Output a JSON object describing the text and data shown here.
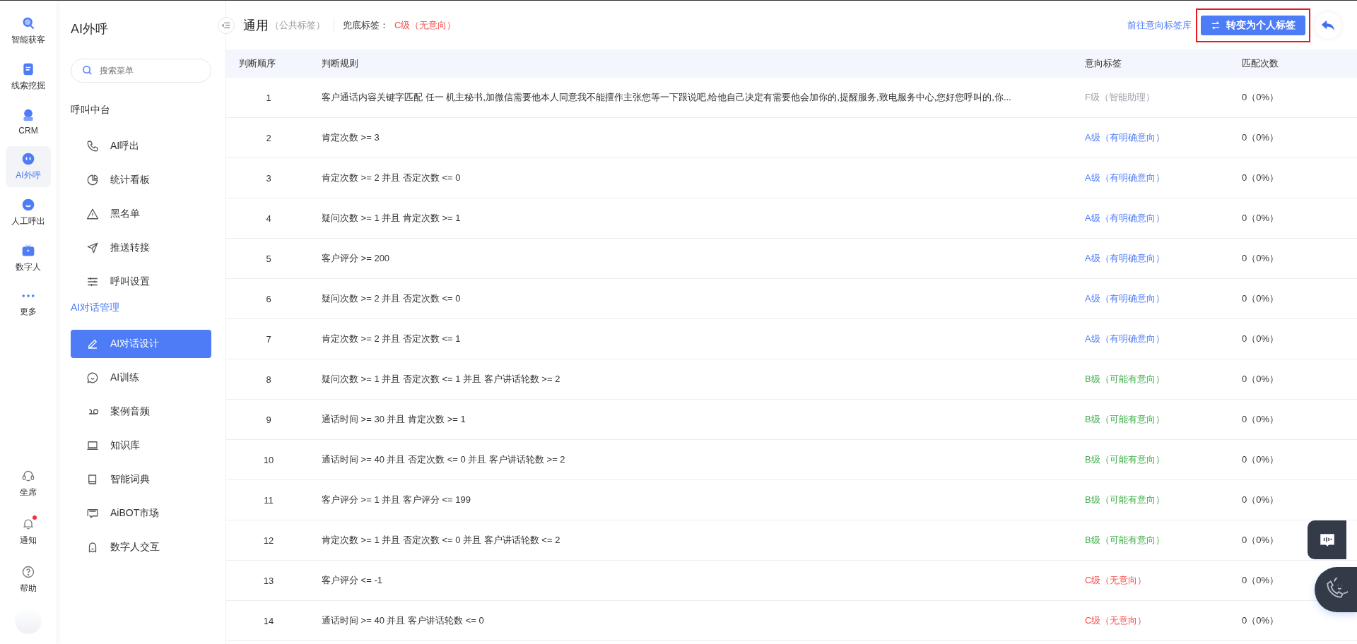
{
  "rail": {
    "items": [
      {
        "label": "智能获客",
        "selected": false
      },
      {
        "label": "线索挖掘",
        "selected": false
      },
      {
        "label": "CRM",
        "selected": false
      },
      {
        "label": "AI外呼",
        "selected": true
      },
      {
        "label": "人工呼出",
        "selected": false
      },
      {
        "label": "数字人",
        "selected": false
      },
      {
        "label": "更多",
        "selected": false
      }
    ],
    "bottom": [
      {
        "label": "坐席",
        "dot": false
      },
      {
        "label": "通知",
        "dot": true
      },
      {
        "label": "帮助",
        "dot": false
      }
    ]
  },
  "sidebar": {
    "title": "AI外呼",
    "search": {
      "placeholder": "搜索菜单"
    },
    "groups": [
      {
        "label": "呼叫中台",
        "active": false,
        "items": [
          {
            "label": "AI呼出",
            "selected": false
          },
          {
            "label": "统计看板",
            "selected": false
          },
          {
            "label": "黑名单",
            "selected": false
          },
          {
            "label": "推送转接",
            "selected": false
          },
          {
            "label": "呼叫设置",
            "selected": false
          }
        ]
      },
      {
        "label": "AI对话管理",
        "active": true,
        "items": [
          {
            "label": "AI对话设计",
            "selected": true
          },
          {
            "label": "AI训练",
            "selected": false
          },
          {
            "label": "案例音频",
            "selected": false
          },
          {
            "label": "知识库",
            "selected": false
          },
          {
            "label": "智能词典",
            "selected": false
          },
          {
            "label": "AiBOT市场",
            "selected": false
          },
          {
            "label": "数字人交互",
            "selected": false
          }
        ]
      }
    ]
  },
  "header": {
    "title": "通用",
    "subtitle": "（公共标签）",
    "fallback_label": "兜底标签：",
    "fallback_value": "C级（无意向）",
    "link": "前往意向标签库",
    "button": "转变为个人标签"
  },
  "table": {
    "columns": [
      "判断顺序",
      "判断规则",
      "意向标签",
      "匹配次数"
    ],
    "rows": [
      {
        "order": "1",
        "rule": "客户通话内容关键字匹配 任一 机主秘书,加微信需要他本人同意我不能擅作主张您等一下跟说吧,给他自己决定有需要他会加你的,提醒服务,致电服务中心,您好您呼叫的,你...",
        "tag": "F级（智能助理）",
        "color": "#a0a3ab",
        "matches": "0（0%）"
      },
      {
        "order": "2",
        "rule": "肯定次数 >= 3",
        "tag": "A级（有明确意向）",
        "color": "#4e7cf6",
        "matches": "0（0%）"
      },
      {
        "order": "3",
        "rule": "肯定次数 >= 2 并且 否定次数 <= 0",
        "tag": "A级（有明确意向）",
        "color": "#4e7cf6",
        "matches": "0（0%）"
      },
      {
        "order": "4",
        "rule": "疑问次数 >= 1 并且 肯定次数 >= 1",
        "tag": "A级（有明确意向）",
        "color": "#4e7cf6",
        "matches": "0（0%）"
      },
      {
        "order": "5",
        "rule": "客户评分 >= 200",
        "tag": "A级（有明确意向）",
        "color": "#4e7cf6",
        "matches": "0（0%）"
      },
      {
        "order": "6",
        "rule": "疑问次数 >= 2 并且 否定次数 <= 0",
        "tag": "A级（有明确意向）",
        "color": "#4e7cf6",
        "matches": "0（0%）"
      },
      {
        "order": "7",
        "rule": "肯定次数 >= 2 并且 否定次数 <= 1",
        "tag": "A级（有明确意向）",
        "color": "#4e7cf6",
        "matches": "0（0%）"
      },
      {
        "order": "8",
        "rule": "疑问次数 >= 1 并且 否定次数 <= 1 并且 客户讲话轮数 >= 2",
        "tag": "B级（可能有意向）",
        "color": "#3fae49",
        "matches": "0（0%）"
      },
      {
        "order": "9",
        "rule": "通话时间 >= 30 并且 肯定次数 >= 1",
        "tag": "B级（可能有意向）",
        "color": "#3fae49",
        "matches": "0（0%）"
      },
      {
        "order": "10",
        "rule": "通话时间 >= 40 并且 否定次数 <= 0 并且 客户讲话轮数 >= 2",
        "tag": "B级（可能有意向）",
        "color": "#3fae49",
        "matches": "0（0%）"
      },
      {
        "order": "11",
        "rule": "客户评分 >= 1 并且 客户评分 <= 199",
        "tag": "B级（可能有意向）",
        "color": "#3fae49",
        "matches": "0（0%）"
      },
      {
        "order": "12",
        "rule": "肯定次数 >= 1 并且 否定次数 <= 0 并且 客户讲话轮数 <= 2",
        "tag": "B级（可能有意向）",
        "color": "#3fae49",
        "matches": "0（0%）"
      },
      {
        "order": "13",
        "rule": "客户评分 <= -1",
        "tag": "C级（无意向）",
        "color": "#f5504f",
        "matches": "0（0%）"
      },
      {
        "order": "14",
        "rule": "通话时间 >= 40 并且 客户讲话轮数 <= 0",
        "tag": "C级（无意向）",
        "color": "#f5504f",
        "matches": "0（0%）"
      }
    ]
  }
}
